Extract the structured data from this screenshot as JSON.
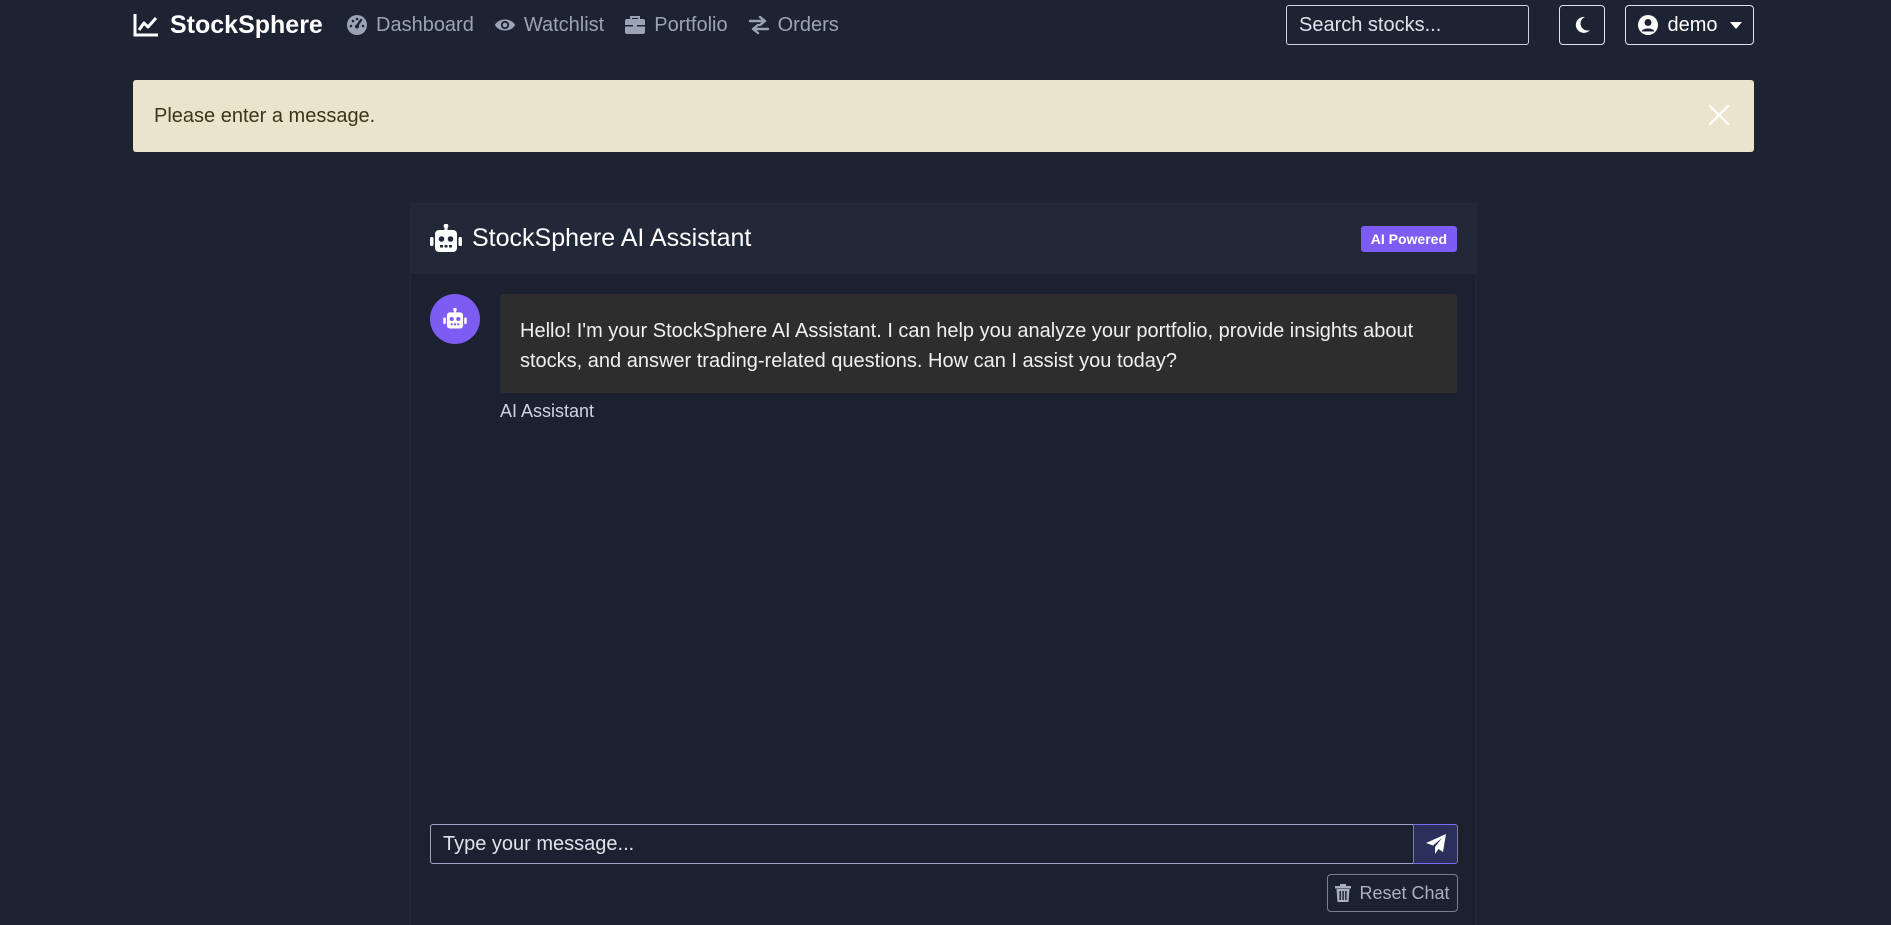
{
  "navbar": {
    "brand": "StockSphere",
    "brand_icon": "chart-line-icon",
    "links": [
      {
        "label": "Dashboard",
        "icon": "gauge-icon"
      },
      {
        "label": "Watchlist",
        "icon": "eye-icon"
      },
      {
        "label": "Portfolio",
        "icon": "briefcase-icon"
      },
      {
        "label": "Orders",
        "icon": "exchange-arrows-icon"
      }
    ],
    "search_placeholder": "Search stocks...",
    "theme_icon": "moon-icon",
    "user": "demo",
    "user_icon": "user-circle-icon"
  },
  "alert": {
    "message": "Please enter a message.",
    "close_icon": "close-icon"
  },
  "chat": {
    "title": "StockSphere AI Assistant",
    "title_icon": "robot-icon",
    "badge": "AI Powered",
    "messages": [
      {
        "sender": "AI Assistant",
        "avatar_icon": "robot-icon",
        "text": "Hello! I'm your StockSphere AI Assistant. I can help you analyze your portfolio, provide insights about stocks, and answer trading-related questions. How can I assist you today?"
      }
    ],
    "input_placeholder": "Type your message...",
    "send_icon": "paper-plane-icon",
    "reset_label": "Reset Chat",
    "reset_icon": "trash-icon"
  },
  "colors": {
    "background": "#1e2333",
    "accent": "#7c5cf3",
    "alert_bg": "#ebe4cd",
    "bubble_bg": "#2d2d2d"
  }
}
